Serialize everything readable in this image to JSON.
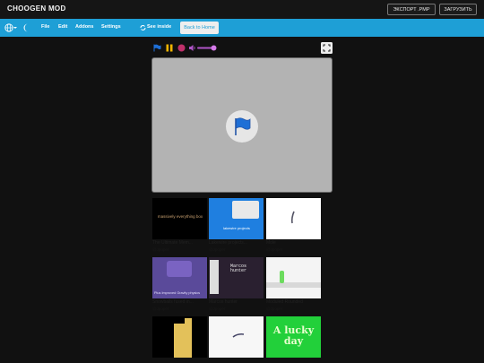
{
  "brand": "CHOOGEN MOD",
  "top_buttons": {
    "export": "ЭКСПОРТ .PMP",
    "upload": "ЗАГРУЗИТЬ"
  },
  "menu": {
    "file": "File",
    "edit": "Edit",
    "addons": "Addons",
    "settings": "Settings",
    "see_inside": "See inside",
    "back_home": "Back to Home"
  },
  "projects": [
    {
      "title": "The Ultimate Mem...",
      "author": "@Jpoper",
      "thumb_text": "massively everything box"
    },
    {
      "title": "Lakewire projects...",
      "author": "@Jpoper",
      "thumb_text": "lakewire projects"
    },
    {
      "title": "Mole",
      "author": "@Jpoper",
      "thumb_text": ""
    },
    {
      "title": "Snowballs fused in...",
      "author": "@Jpoper",
      "thumb_text": "Plus Improved Gravity physics"
    },
    {
      "title": "Marcos hunter",
      "author": "@Jpoper",
      "thumb_text": "Marcos hunter"
    },
    {
      "title": "Moduled Rounded",
      "author": "@Jpoper",
      "thumb_text": ""
    },
    {
      "title": "",
      "author": "",
      "thumb_text": ""
    },
    {
      "title": "",
      "author": "",
      "thumb_text": ""
    },
    {
      "title": "",
      "author": "",
      "thumb_text": "A lucky day"
    }
  ],
  "colors": {
    "menubar": "#1e9fd6",
    "stage": "#b3b3b3",
    "accent_flag": "#1e6fd6"
  }
}
